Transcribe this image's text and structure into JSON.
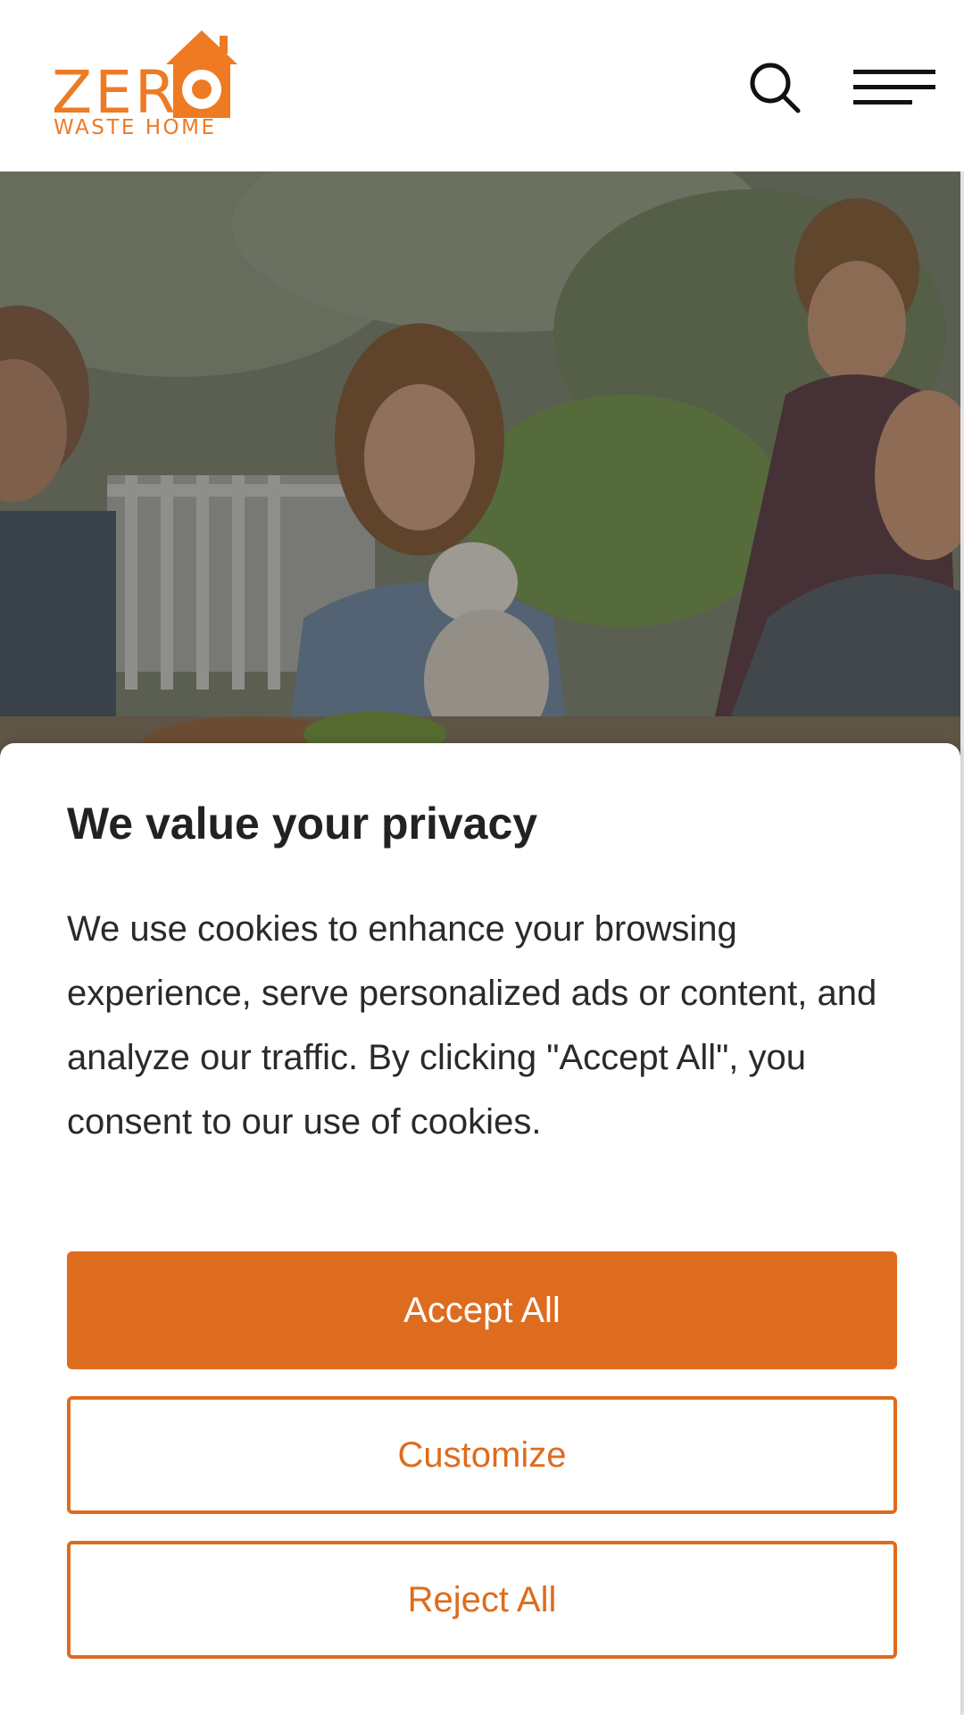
{
  "header": {
    "logo_word": "ZER",
    "logo_sub": "WASTE HOME",
    "search_icon": "search-icon",
    "menu_icon": "hamburger-menu-icon"
  },
  "hero": {
    "image_description": "family-outdoor-photo"
  },
  "consent": {
    "title": "We value your privacy",
    "body": "We use cookies to enhance your browsing experience, serve personalized ads or content, and analyze our traffic. By clicking \"Accept All\", you consent to our use of cookies.",
    "accept_label": "Accept All",
    "customize_label": "Customize",
    "reject_label": "Reject All"
  },
  "colors": {
    "brand_orange": "#ef7a24",
    "button_orange": "#de6c1e",
    "text_dark": "#222222"
  }
}
